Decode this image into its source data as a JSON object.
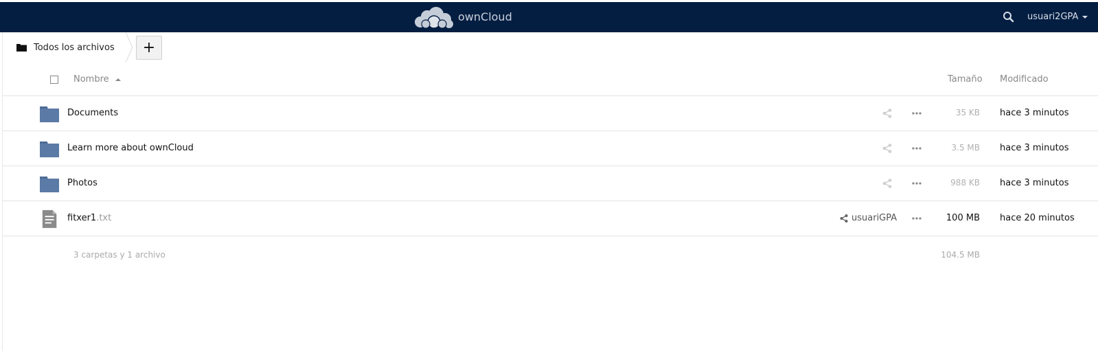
{
  "app": {
    "name": "ownCloud",
    "colors": {
      "topbar": "#041e42",
      "folder": "#5b7aa6",
      "file": "#8a8a8a"
    }
  },
  "header": {
    "user": "usuari2GPA",
    "search_icon": "search-icon"
  },
  "breadcrumb": {
    "root_label": "Todos los archivos",
    "add_label": "+"
  },
  "table": {
    "columns": {
      "name": "Nombre",
      "size": "Tamaño",
      "modified": "Modificado"
    },
    "rows": [
      {
        "name": "Documents",
        "ext": "",
        "type": "folder",
        "size": "35 KB",
        "modified": "hace 3 minutos",
        "shared_with": ""
      },
      {
        "name": "Learn more about ownCloud",
        "ext": "",
        "type": "folder",
        "size": "3.5 MB",
        "modified": "hace 3 minutos",
        "shared_with": ""
      },
      {
        "name": "Photos",
        "ext": "",
        "type": "folder",
        "size": "988 KB",
        "modified": "hace 3 minutos",
        "shared_with": ""
      },
      {
        "name": "fitxer1",
        "ext": ".txt",
        "type": "file",
        "size": "100 MB",
        "modified": "hace 20 minutos",
        "shared_with": "usuariGPA"
      }
    ],
    "summary": {
      "text": "3 carpetas y 1 archivo",
      "size": "104.5 MB"
    }
  }
}
